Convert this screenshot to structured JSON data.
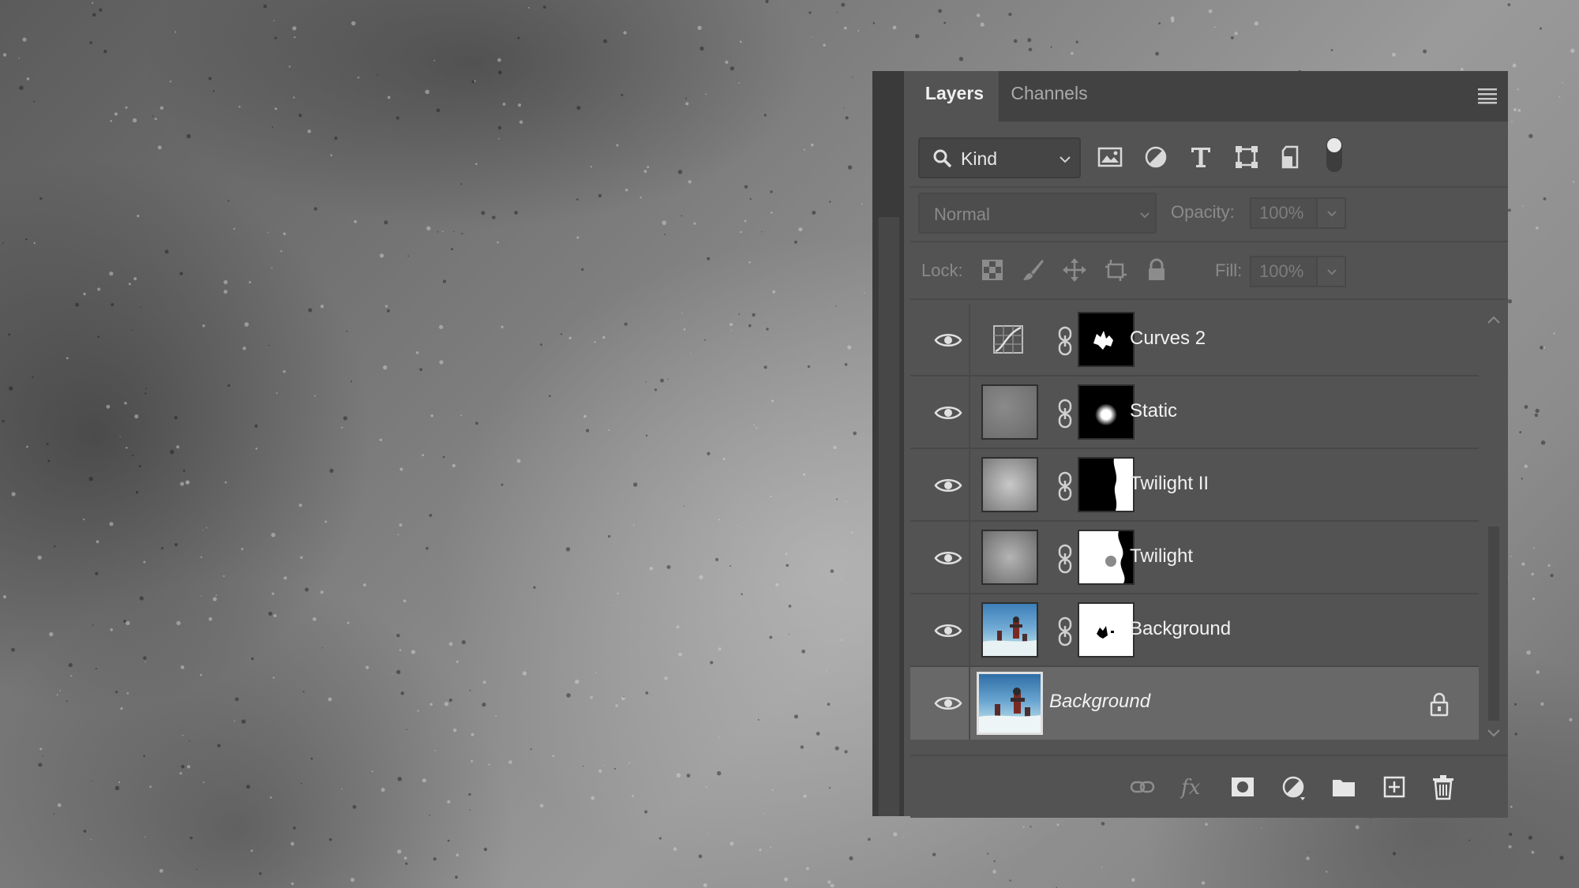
{
  "panel": {
    "tabs": [
      {
        "label": "Layers",
        "active": true
      },
      {
        "label": "Channels",
        "active": false
      }
    ],
    "filter": {
      "kind_label": "Kind",
      "icons": [
        "pixel-layer-filter-icon",
        "adjustment-layer-filter-icon",
        "type-layer-filter-icon",
        "shape-layer-filter-icon",
        "smart-object-filter-icon",
        "filter-toggle-icon"
      ]
    },
    "blend": {
      "mode": "Normal",
      "opacity_label": "Opacity:",
      "opacity_value": "100%"
    },
    "lock": {
      "label": "Lock:",
      "icons": [
        "lock-transparent-pixels-icon",
        "lock-image-pixels-icon",
        "lock-position-icon",
        "lock-artboard-icon",
        "lock-all-icon"
      ],
      "fill_label": "Fill:",
      "fill_value": "100%"
    },
    "layers": [
      {
        "name": "Curves 2",
        "type": "adjustment",
        "visible": true
      },
      {
        "name": "Static",
        "type": "texture",
        "visible": true
      },
      {
        "name": "Twilight II",
        "type": "texture",
        "visible": true
      },
      {
        "name": "Twilight",
        "type": "texture",
        "visible": true
      },
      {
        "name": "Background",
        "type": "photo",
        "visible": true
      },
      {
        "name": "Background",
        "type": "background",
        "visible": true,
        "locked": true,
        "selected": true
      }
    ],
    "bottom_icons": [
      "link-layers-icon",
      "fx-icon",
      "add-mask-icon",
      "adjustment-layer-icon",
      "new-group-icon",
      "new-layer-icon",
      "delete-layer-icon"
    ]
  },
  "colors": {
    "panel_bg": "#535353",
    "tab_bar": "#424242",
    "selected_row": "#686868",
    "text": "#f2f2f2",
    "dim_text": "#8a8a8a"
  }
}
